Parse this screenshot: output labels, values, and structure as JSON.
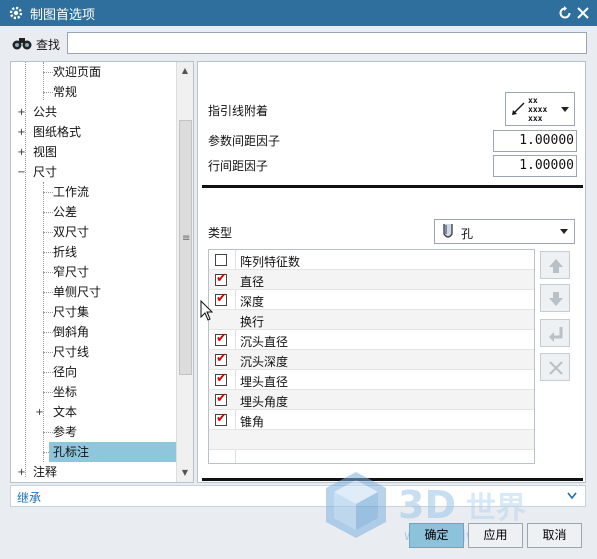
{
  "window": {
    "title": "制图首选项"
  },
  "search": {
    "label": "查找",
    "value": ""
  },
  "tree": {
    "items": [
      {
        "label": "欢迎页面"
      },
      {
        "label": "常规"
      },
      {
        "label": "公共"
      },
      {
        "label": "图纸格式"
      },
      {
        "label": "视图"
      },
      {
        "label": "尺寸"
      },
      {
        "label": "工作流"
      },
      {
        "label": "公差"
      },
      {
        "label": "双尺寸"
      },
      {
        "label": "折线"
      },
      {
        "label": "窄尺寸"
      },
      {
        "label": "单侧尺寸"
      },
      {
        "label": "尺寸集"
      },
      {
        "label": "倒斜角"
      },
      {
        "label": "尺寸线"
      },
      {
        "label": "径向"
      },
      {
        "label": "坐标"
      },
      {
        "label": "文本"
      },
      {
        "label": "参考"
      },
      {
        "label": "孔标注"
      },
      {
        "label": "注释"
      }
    ],
    "selected": "孔标注"
  },
  "panel": {
    "leader_attach_label": "指引线附着",
    "leader_icon_text": [
      "xx",
      "xxxx",
      "xxx"
    ],
    "param_spacing_label": "参数间距因子",
    "param_spacing_value": "1.00000",
    "line_spacing_label": "行间距因子",
    "line_spacing_value": "1.00000",
    "type_label": "类型",
    "type_value": "孔",
    "list": [
      {
        "label": "阵列特征数",
        "checked": false
      },
      {
        "label": "直径",
        "checked": true
      },
      {
        "label": "深度",
        "checked": true
      },
      {
        "label": "换行",
        "checked": null
      },
      {
        "label": "沉头直径",
        "checked": true
      },
      {
        "label": "沉头深度",
        "checked": true
      },
      {
        "label": "埋头直径",
        "checked": true
      },
      {
        "label": "埋头角度",
        "checked": true
      },
      {
        "label": "锥角",
        "checked": true
      }
    ]
  },
  "inherit": {
    "label": "继承"
  },
  "buttons": {
    "ok": "确定",
    "apply": "应用",
    "cancel": "取消"
  },
  "watermark": {
    "site": "www.3dsjw.com"
  },
  "colors": {
    "titlebar": "#2f6f9e",
    "selected": "#8ec7dc",
    "check": "#dd0000",
    "link": "#1f6fb0"
  }
}
